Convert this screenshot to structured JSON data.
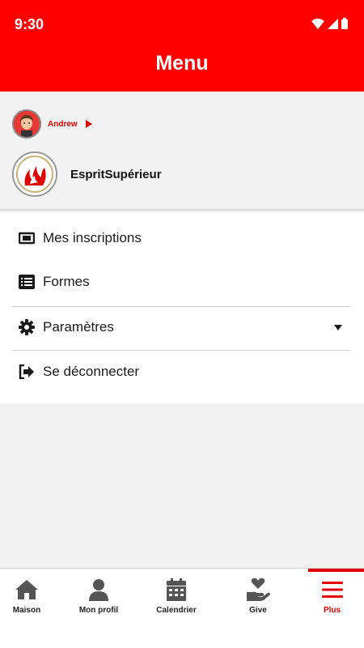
{
  "status_bar": {
    "time": "9:30"
  },
  "header": {
    "title": "Menu"
  },
  "profile": {
    "user_name": "Andrew",
    "org_name": "EspritSupérieur"
  },
  "menu": {
    "items": [
      {
        "label": "Mes inscriptions",
        "icon": "ticket-icon"
      },
      {
        "label": "Formes",
        "icon": "list-icon"
      },
      {
        "label": "Paramètres",
        "icon": "gear-icon"
      },
      {
        "label": "Se déconnecter",
        "icon": "logout-icon"
      }
    ]
  },
  "bottom_nav": {
    "items": [
      {
        "label": "Maison",
        "icon": "home-icon"
      },
      {
        "label": "Mon profil",
        "icon": "user-icon"
      },
      {
        "label": "Calendrier",
        "icon": "calendar-icon"
      },
      {
        "label": "Give",
        "icon": "give-icon"
      },
      {
        "label": "Plus",
        "icon": "hamburger-icon",
        "active": true
      }
    ]
  },
  "colors": {
    "brand": "#ff0000",
    "accent": "#e00000"
  }
}
